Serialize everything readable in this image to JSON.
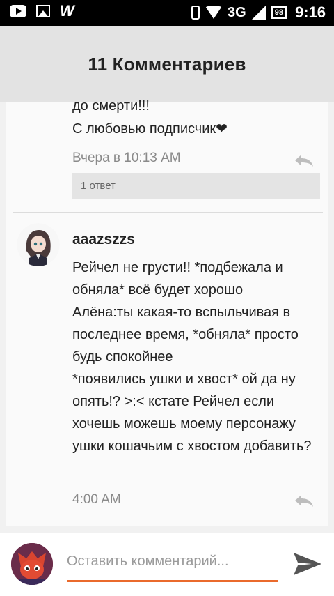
{
  "status_bar": {
    "network": "3G",
    "battery": "98",
    "time": "9:16"
  },
  "header": {
    "title": "11 Комментариев"
  },
  "comment_1": {
    "text_line1": "до смерти!!!",
    "text_line2": "С любовью подписчик❤",
    "time": "Вчера в 10:13 AM",
    "replies": "1 ответ"
  },
  "comment_2": {
    "author": "aaazszzs",
    "text": "Рейчел не грусти!! *подбежала и обняла* всё будет хорошо\nАлёна:ты какая-то вспыльчивая в последнее время, *обняла* просто будь спокойнее\n*появились ушки и хвост* ой да ну опять!? >:< кстате Рейчел если хочешь можешь моему персонажу ушки кошачьим с хвостом добавить?",
    "time": "4:00 AM"
  },
  "composer": {
    "placeholder": "Оставить комментарий..."
  },
  "colors": {
    "accent": "#ea6a2c",
    "header_bg": "#e3e3e3",
    "meta_text": "#8a8a8a"
  },
  "icons": [
    "youtube-icon",
    "gallery-icon",
    "wattpad-icon",
    "sim-icon",
    "wifi-icon",
    "signal-icon",
    "battery-icon",
    "reply-icon",
    "send-icon"
  ]
}
